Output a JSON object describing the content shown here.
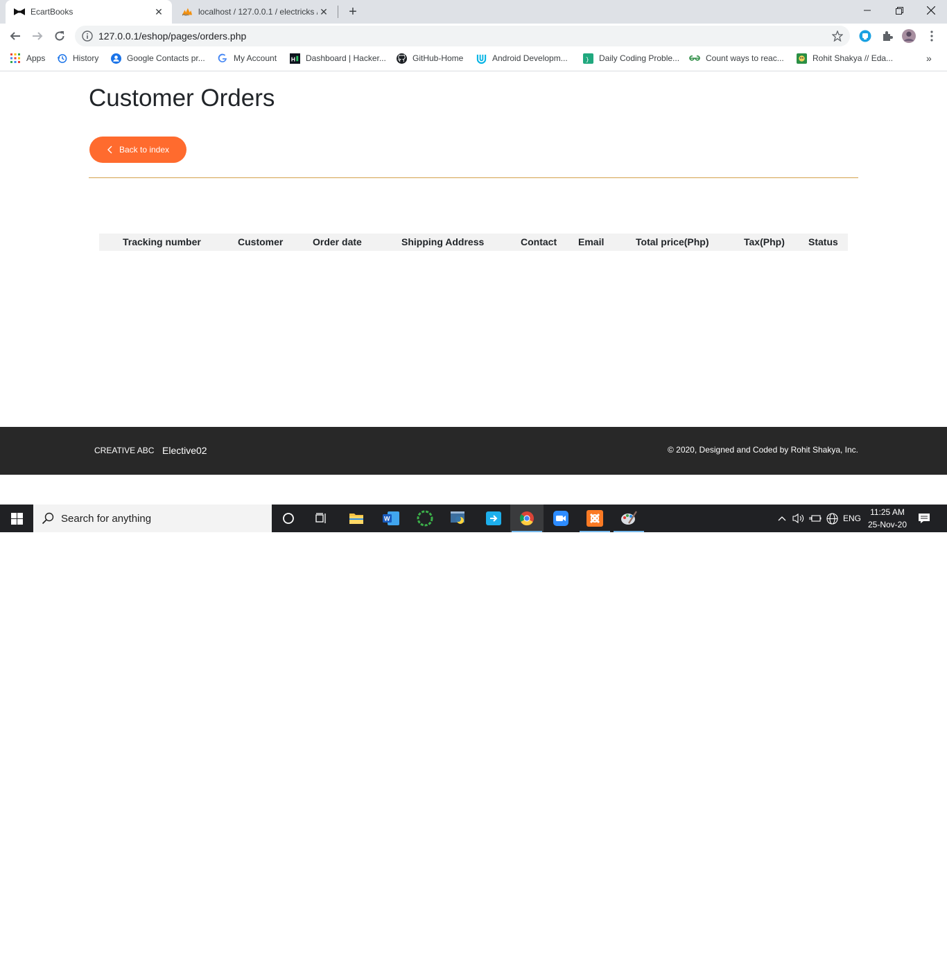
{
  "browser": {
    "tabs": [
      {
        "title": "EcartBooks",
        "active": true
      },
      {
        "title": "localhost / 127.0.0.1 / electricks /",
        "active": false
      }
    ],
    "address": "127.0.0.1/eshop/pages/orders.php"
  },
  "bookmarks": [
    {
      "label": "Apps",
      "icon": "apps-grid-icon"
    },
    {
      "label": "History",
      "icon": "history-icon"
    },
    {
      "label": "Google Contacts pr...",
      "icon": "contacts-icon"
    },
    {
      "label": "My Account",
      "icon": "google-icon"
    },
    {
      "label": "Dashboard | Hacker...",
      "icon": "hackerrank-icon"
    },
    {
      "label": "GitHub-Home",
      "icon": "github-icon"
    },
    {
      "label": "Android Developm...",
      "icon": "udacity-icon"
    },
    {
      "label": "Daily Coding Proble...",
      "icon": "dcp-icon"
    },
    {
      "label": "Count ways to reac...",
      "icon": "gfg-icon"
    },
    {
      "label": "Rohit Shakya // Eda...",
      "icon": "edabit-icon"
    }
  ],
  "page": {
    "title": "Customer Orders",
    "back_label": "Back to index",
    "table_headers": [
      "Tracking number",
      "Customer",
      "Order date",
      "Shipping Address",
      "Contact",
      "Email",
      "Total price(Php)",
      "Tax(Php)",
      "Status"
    ]
  },
  "footer": {
    "brand": "CREATIVE ABC",
    "course": "Elective02",
    "copyright": "© 2020, Designed and Coded by Rohit Shakya, Inc."
  },
  "taskbar": {
    "search_placeholder": "Search for anything",
    "language": "ENG",
    "time": "11:25 AM",
    "date": "25-Nov-20"
  },
  "colors": {
    "accent_button": "#ff6b2e",
    "divider": "#d4a24c",
    "footer_bg": "#282828"
  }
}
